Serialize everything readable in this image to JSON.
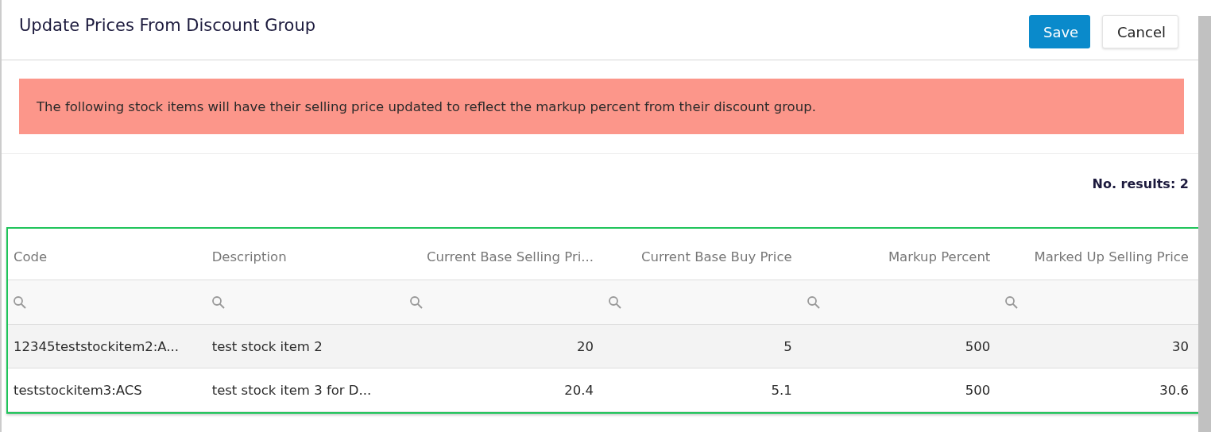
{
  "dialog": {
    "title": "Update Prices From Discount Group",
    "buttons": [
      {
        "label": "Save",
        "kind": "primary"
      },
      {
        "label": "Cancel",
        "kind": "secondary"
      }
    ]
  },
  "banner": {
    "text": "The following stock items will have their selling price updated to reflect the markup percent from their discount group."
  },
  "results": {
    "label": "No. results: 2"
  },
  "table": {
    "columns": [
      {
        "label": "Code",
        "kind": "text"
      },
      {
        "label": "Description",
        "kind": "text"
      },
      {
        "label": "Current Base Selling Pri...",
        "kind": "number"
      },
      {
        "label": "Current Base Buy Price",
        "kind": "number"
      },
      {
        "label": "Markup Percent",
        "kind": "number"
      },
      {
        "label": "Marked Up Selling Price",
        "kind": "number"
      }
    ],
    "rows": [
      [
        "12345teststockitem2:A...",
        "test stock item 2",
        "20",
        "5",
        "500",
        "30"
      ],
      [
        "teststockitem3:ACS",
        "test stock item 3 for D...",
        "20.4",
        "5.1",
        "500",
        "30.6"
      ]
    ]
  }
}
